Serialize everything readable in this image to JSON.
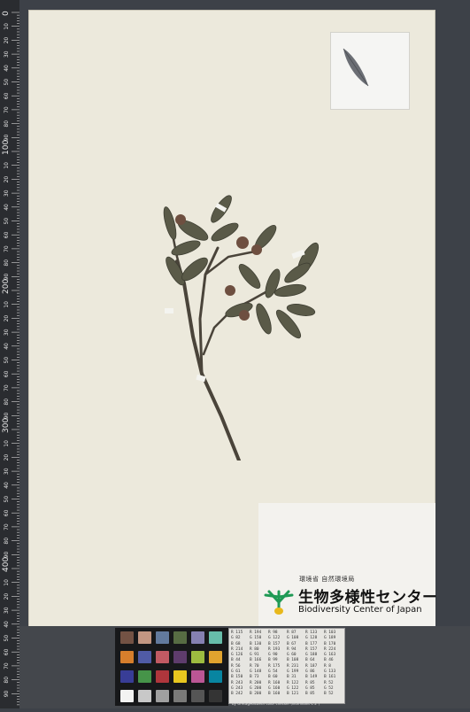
{
  "logo": {
    "ministry": "環境省 自然環境局",
    "name_jp": "生物多様性センター",
    "name_en": "Biodiversity Center of Japan"
  },
  "ruler": {
    "major_labels": [
      "0",
      "100",
      "200",
      "300",
      "400",
      "500"
    ],
    "minor_labels": [
      "10",
      "20",
      "30",
      "40",
      "50",
      "60",
      "70",
      "80",
      "90"
    ]
  },
  "color_card": {
    "rows": [
      [
        "R 115",
        "R 194",
        "R 98",
        "R 87",
        "R 133",
        "R 103"
      ],
      [
        "G 82",
        "G 150",
        "G 122",
        "G 108",
        "G 128",
        "G 189"
      ],
      [
        "B 68",
        "B 130",
        "B 157",
        "B 67",
        "B 177",
        "B 170"
      ],
      [
        "R 214",
        "R 80",
        "R 193",
        "R 94",
        "R 157",
        "R 224"
      ],
      [
        "G 126",
        "G 91",
        "G 90",
        "G 60",
        "G 188",
        "G 163"
      ],
      [
        "B 44",
        "B 166",
        "B 99",
        "B 108",
        "B 64",
        "B 46"
      ],
      [
        "R 56",
        "R 70",
        "R 175",
        "R 231",
        "R 187",
        "R 8"
      ],
      [
        "G 61",
        "G 148",
        "G 54",
        "G 199",
        "G 86",
        "G 133"
      ],
      [
        "B 150",
        "B 73",
        "B 60",
        "B 31",
        "B 149",
        "B 161"
      ],
      [
        "R 243",
        "R 200",
        "R 160",
        "R 122",
        "R 85",
        "R 52"
      ],
      [
        "G 243",
        "G 200",
        "G 160",
        "G 122",
        "G 85",
        "G 52"
      ],
      [
        "B 242",
        "B 200",
        "B 160",
        "B 121",
        "B 85",
        "B 52"
      ]
    ],
    "caption": "by GretagMacbeth color checker (illuminant C 2°)"
  },
  "colors": {
    "background": "#3d4148",
    "sheet": "#ece9dc",
    "leaf": "#5a5a48",
    "stem": "#4a443a"
  }
}
